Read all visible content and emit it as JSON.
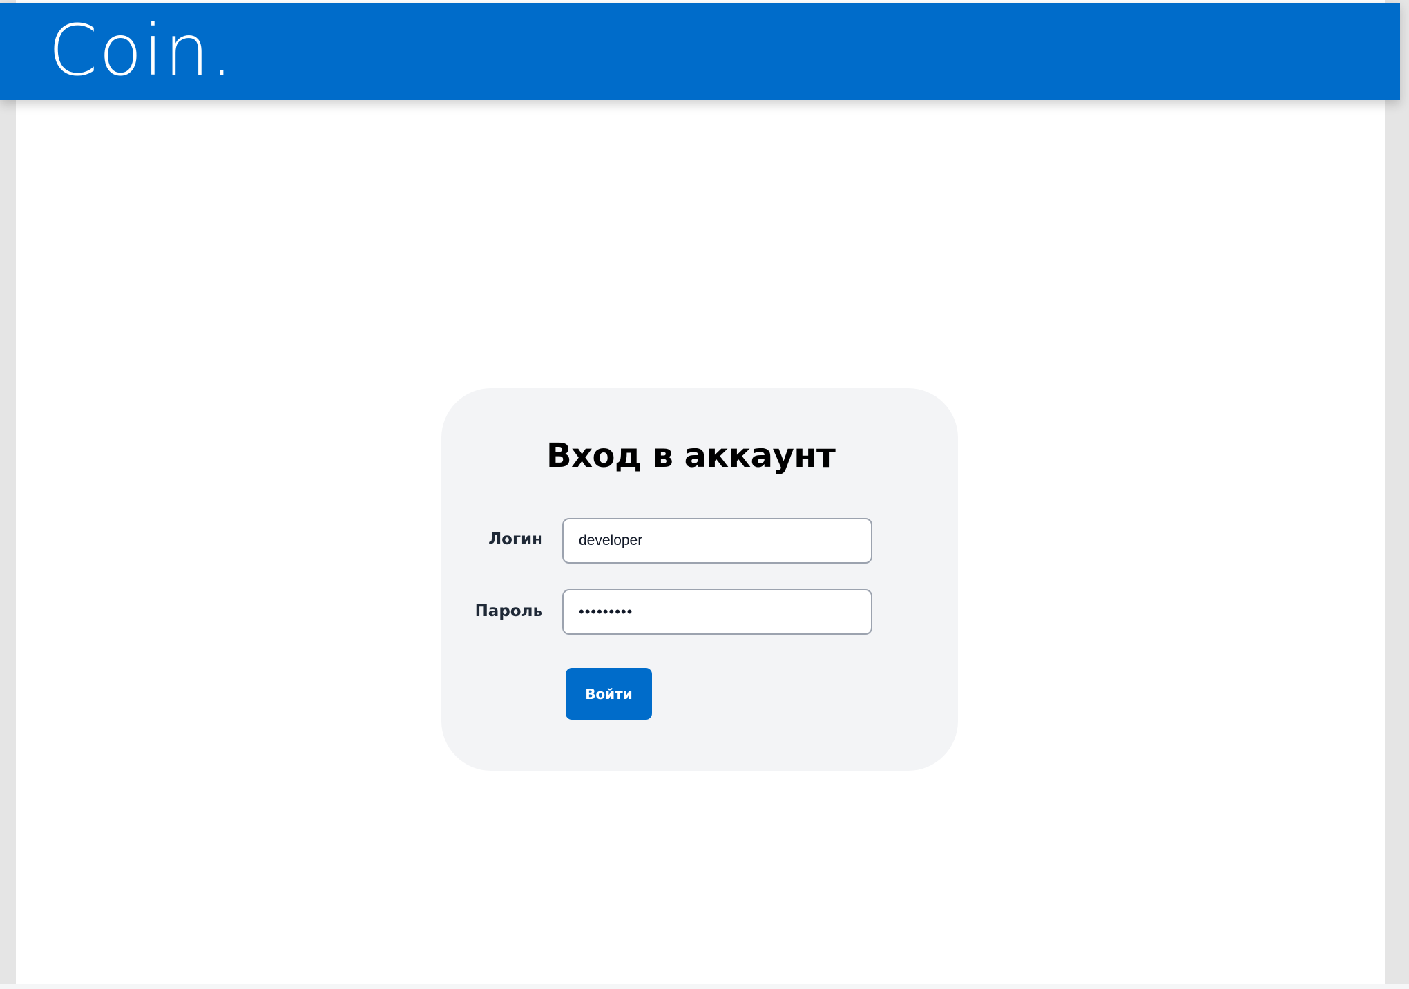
{
  "header": {
    "logo": "Coin."
  },
  "login_form": {
    "title": "Вход в аккаунт",
    "login_label": "Логин",
    "login_value": "developer",
    "password_label": "Пароль",
    "password_value": "developer",
    "submit_label": "Войти"
  },
  "colors": {
    "brand": "#006cca",
    "card_background": "#f3f4f6"
  }
}
